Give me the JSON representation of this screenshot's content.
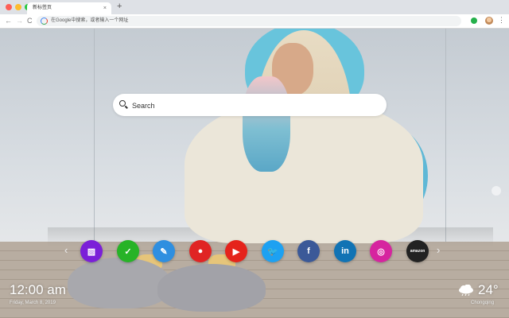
{
  "browser": {
    "tab_title": "新标签页",
    "tab_close": "×",
    "new_tab": "+",
    "omnibox_text": "在Google中搜索，或者输入一个网址",
    "nav_back": "←",
    "nav_forward": "→",
    "nav_reload": "C",
    "menu": "⋮"
  },
  "search": {
    "placeholder": "Search"
  },
  "shortcuts": {
    "prev": "‹",
    "next": "›",
    "items": [
      {
        "name": "gallery",
        "icon": "image-icon",
        "color": "#7b1fd8",
        "glyph": "▨"
      },
      {
        "name": "tasks",
        "icon": "checkbox-icon",
        "color": "#27b327",
        "glyph": "✓"
      },
      {
        "name": "notes",
        "icon": "notepad-icon",
        "color": "#2f8fe0",
        "glyph": "✎"
      },
      {
        "name": "games",
        "icon": "gamepad-icon",
        "color": "#e02424",
        "glyph": "●"
      },
      {
        "name": "youtube",
        "icon": "youtube-icon",
        "color": "#e5231b",
        "glyph": "▶"
      },
      {
        "name": "twitter",
        "icon": "twitter-icon",
        "color": "#1da1f2",
        "glyph": "🐦"
      },
      {
        "name": "facebook",
        "icon": "facebook-icon",
        "color": "#3b5998",
        "glyph": "f"
      },
      {
        "name": "linkedin",
        "icon": "linkedin-icon",
        "color": "#1173b4",
        "glyph": "in"
      },
      {
        "name": "instagram",
        "icon": "instagram-icon",
        "color": "#d6249f",
        "glyph": "◎"
      },
      {
        "name": "amazon",
        "icon": "amazon-icon",
        "color": "#222222",
        "glyph": "amazon"
      }
    ]
  },
  "clock": {
    "time": "12:00 am",
    "date": "Friday, March 8, 2019"
  },
  "weather": {
    "icon": "cloud-rain-icon",
    "temp": "24°",
    "city": "Chongqing"
  }
}
